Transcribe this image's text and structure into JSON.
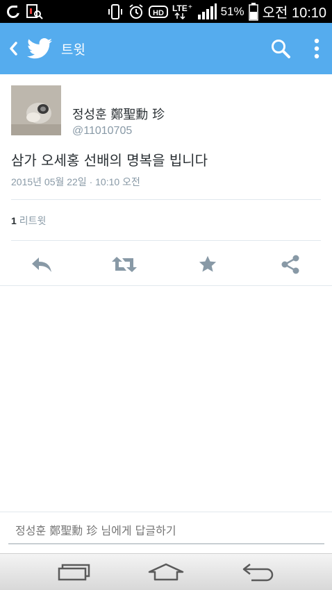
{
  "status_bar": {
    "battery_percent": "51%",
    "network": "LTE",
    "time": "오전 10:10",
    "icons": [
      "olleh-icon",
      "notification-icon",
      "vibrate-icon",
      "alarm-icon",
      "hd-voice-icon",
      "lte-icon",
      "signal-icon",
      "battery-icon"
    ]
  },
  "action_bar": {
    "title": "트윗",
    "icons": [
      "back-arrow-icon",
      "twitter-bird-icon",
      "search-icon",
      "overflow-menu-icon"
    ],
    "accent_color": "#55acee"
  },
  "tweet": {
    "author_name": "정성훈 鄭聖勳 珍",
    "author_handle": "@11010705",
    "text": "삼가 오세홍 선배의 명복을 빕니다",
    "timestamp": "2015년 05월 22일 · 10:10 오전",
    "retweet_count": "1",
    "retweet_label": "리트윗",
    "actions": [
      "reply-icon",
      "retweet-icon",
      "favorite-icon",
      "share-icon"
    ]
  },
  "reply": {
    "placeholder": "정성훈 鄭聖勳 珍 님에게 답글하기"
  },
  "nav_bar": {
    "buttons": [
      "recent-apps-icon",
      "home-icon",
      "back-icon"
    ]
  }
}
